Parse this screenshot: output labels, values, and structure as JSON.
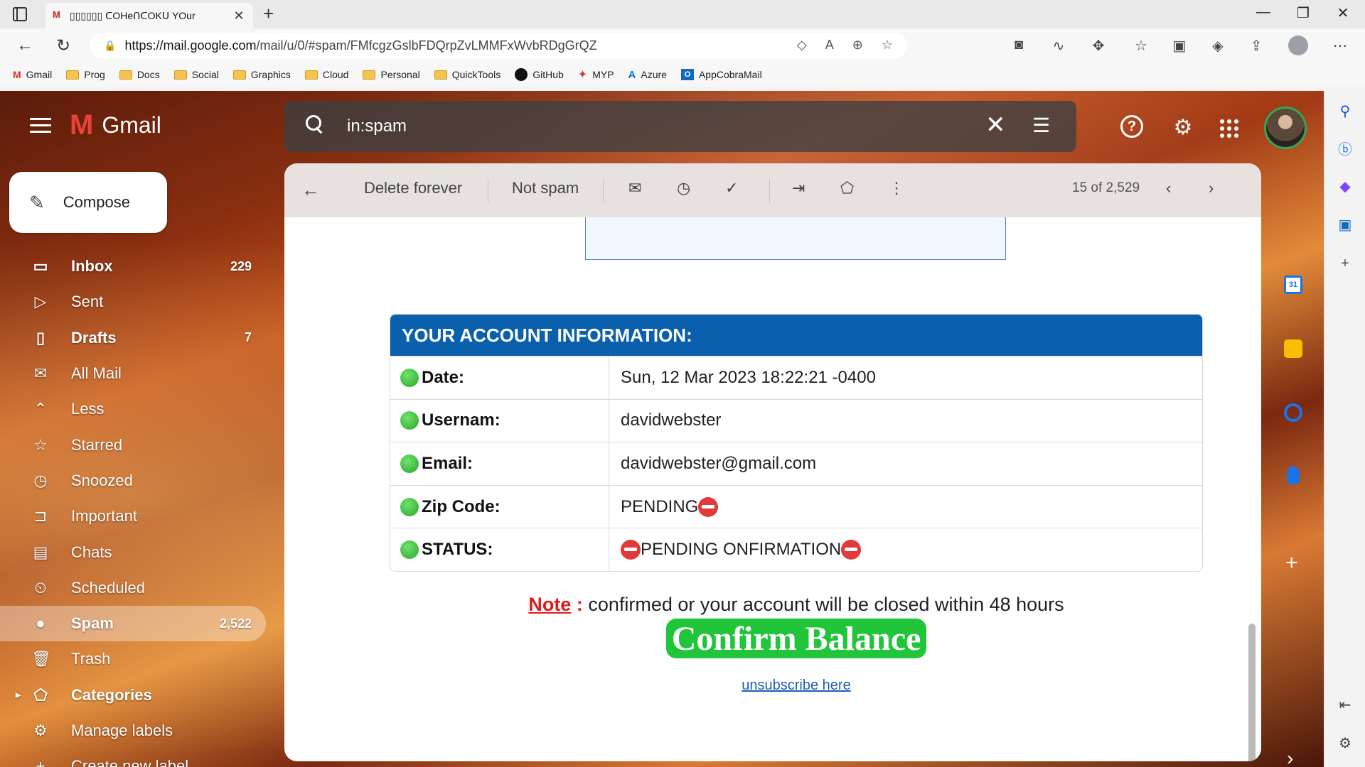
{
  "browser": {
    "tab_title": "▯▯▯▯▯▯ ᑕOHeᑎᑕOKᑌ YOur",
    "url_host": "https://mail.google.com",
    "url_path": "/mail/u/0/#spam/FMfcgzGslbFDQrpZvLMMFxWvbRDgGrQZ",
    "bookmarks": [
      {
        "label": "Gmail",
        "icon": "gmail-icon"
      },
      {
        "label": "Prog",
        "icon": "folder-icon"
      },
      {
        "label": "Docs",
        "icon": "folder-icon"
      },
      {
        "label": "Social",
        "icon": "folder-icon"
      },
      {
        "label": "Graphics",
        "icon": "folder-icon"
      },
      {
        "label": "Cloud",
        "icon": "folder-icon"
      },
      {
        "label": "Personal",
        "icon": "folder-icon"
      },
      {
        "label": "QuickTools",
        "icon": "folder-icon"
      },
      {
        "label": "GitHub",
        "icon": "github-icon"
      },
      {
        "label": "MYP",
        "icon": "myp-icon"
      },
      {
        "label": "Azure",
        "icon": "azure-icon"
      },
      {
        "label": "AppCobraMail",
        "icon": "outlook-icon"
      }
    ]
  },
  "gmail": {
    "brand": "Gmail",
    "search_query": "in:spam",
    "compose_label": "Compose",
    "nav": [
      {
        "label": "Inbox",
        "count": "229",
        "bold": true,
        "icon": "inbox-icon"
      },
      {
        "label": "Sent",
        "count": "",
        "bold": false,
        "icon": "send-icon"
      },
      {
        "label": "Drafts",
        "count": "7",
        "bold": true,
        "icon": "draft-icon"
      },
      {
        "label": "All Mail",
        "count": "",
        "bold": false,
        "icon": "all-mail-icon"
      },
      {
        "label": "Less",
        "count": "",
        "bold": false,
        "icon": "chevron-up-icon"
      },
      {
        "label": "Starred",
        "count": "",
        "bold": false,
        "icon": "star-icon"
      },
      {
        "label": "Snoozed",
        "count": "",
        "bold": false,
        "icon": "clock-icon"
      },
      {
        "label": "Important",
        "count": "",
        "bold": false,
        "icon": "important-icon"
      },
      {
        "label": "Chats",
        "count": "",
        "bold": false,
        "icon": "chat-icon"
      },
      {
        "label": "Scheduled",
        "count": "",
        "bold": false,
        "icon": "scheduled-icon"
      },
      {
        "label": "Spam",
        "count": "2,522",
        "bold": true,
        "icon": "spam-icon",
        "active": true
      },
      {
        "label": "Trash",
        "count": "",
        "bold": false,
        "icon": "trash-icon"
      },
      {
        "label": "Categories",
        "count": "",
        "bold": true,
        "icon": "label-icon"
      },
      {
        "label": "Manage labels",
        "count": "",
        "bold": false,
        "icon": "gear-icon"
      },
      {
        "label": "Create new label",
        "count": "",
        "bold": false,
        "icon": "plus-icon"
      }
    ],
    "toolbar": {
      "delete_forever": "Delete forever",
      "not_spam": "Not spam",
      "pagination": "15 of 2,529"
    }
  },
  "email": {
    "account_header": "YOUR ACCOUNT INFORMATION:",
    "rows": [
      {
        "key": "Date:",
        "value": "Sun, 12 Mar 2023 18:22:21 -0400"
      },
      {
        "key": "Usernam:",
        "value": "davidwebster"
      },
      {
        "key": "Email:",
        "value": "davidwebster@gmail.com"
      },
      {
        "key": "Zip Code:",
        "value": "PENDING"
      },
      {
        "key": "STATUS:",
        "value": "PENDING ONFIRMATION"
      }
    ],
    "note_label": "Note",
    "note_sep": " : ",
    "note_text": "confirmed or your account will be closed within 48 hours",
    "confirm_button": "Confirm Balance",
    "unsubscribe": "unsubscribe here"
  }
}
